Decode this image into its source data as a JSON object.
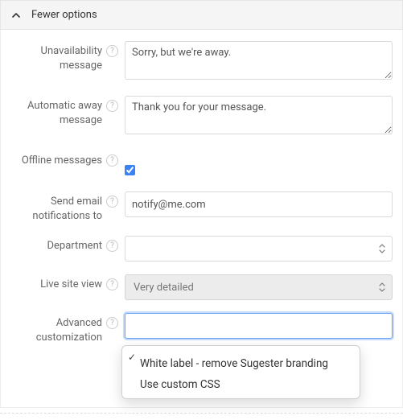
{
  "header": {
    "title": "Fewer options"
  },
  "fields": {
    "unavailability": {
      "label": "Unavailability message",
      "value": "Sorry, but we're away."
    },
    "autoAway": {
      "label": "Automatic away message",
      "value": "Thank you for your message."
    },
    "offline": {
      "label": "Offline messages",
      "checked": true
    },
    "notifyEmail": {
      "label": "Send email notifications to",
      "value": "notify@me.com"
    },
    "department": {
      "label": "Department",
      "value": ""
    },
    "liveSiteView": {
      "label": "Live site view",
      "value": "Very detailed"
    },
    "advanced": {
      "label": "Advanced customization",
      "options": [
        "",
        "White label - remove Sugester branding",
        "Use custom CSS"
      ],
      "selectedIndex": 0
    }
  },
  "help_glyph": "?"
}
